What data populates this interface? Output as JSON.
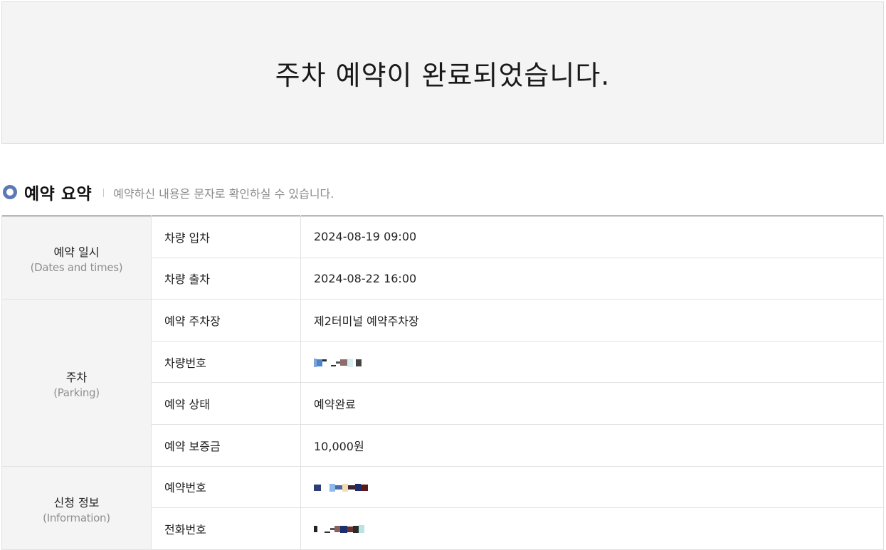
{
  "banner": {
    "title": "주차 예약이 완료되었습니다."
  },
  "summary": {
    "title": "예약 요약",
    "subtitle": "예약하신 내용은 문자로 확인하실 수 있습니다."
  },
  "groups": {
    "dates": {
      "ko": "예약 일시",
      "en": "(Dates and times)"
    },
    "parking": {
      "ko": "주차",
      "en": "(Parking)"
    },
    "info": {
      "ko": "신청 정보",
      "en": "(Information)"
    }
  },
  "rows": {
    "entry": {
      "label": "차량 입차",
      "value": "2024-08-19 09:00"
    },
    "exit": {
      "label": "차량 출차",
      "value": "2024-08-22 16:00"
    },
    "lot": {
      "label": "예약 주차장",
      "value": "제2터미널 예약주차장"
    },
    "plate": {
      "label": "차량번호"
    },
    "status": {
      "label": "예약 상태",
      "value": "예약완료"
    },
    "deposit": {
      "label": "예약 보증금",
      "value": "10,000원"
    },
    "reservation_no": {
      "label": "예약번호"
    },
    "phone": {
      "label": "전화번호"
    }
  },
  "colors": {
    "accent": "#5b79b7",
    "header_bg": "#f4f4f4",
    "border": "#e2e2e2"
  }
}
